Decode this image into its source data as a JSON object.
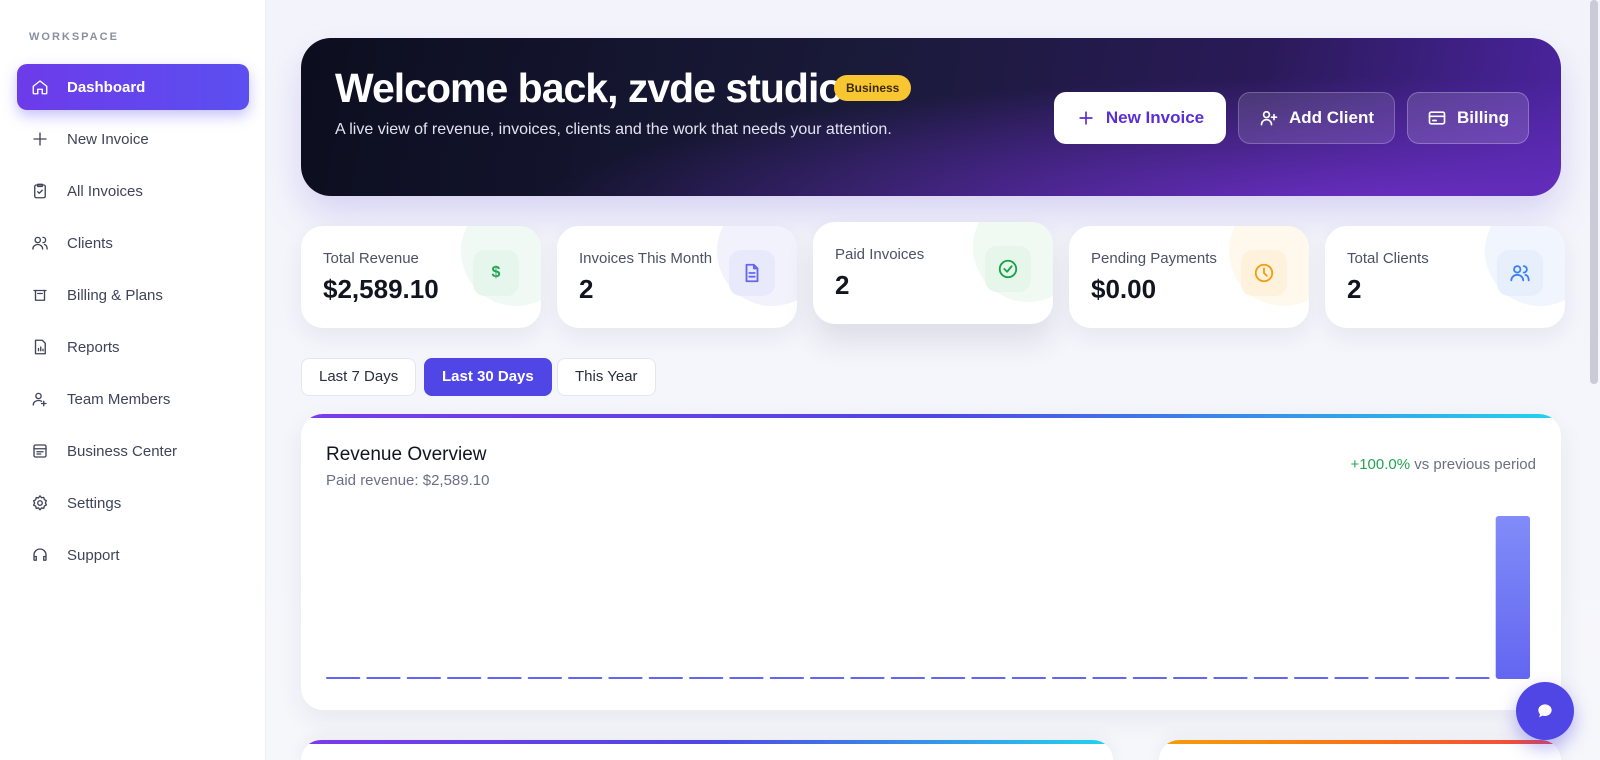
{
  "sidebar": {
    "section_label": "WORKSPACE",
    "items": [
      {
        "label": "Dashboard",
        "icon": "home-icon",
        "active": true
      },
      {
        "label": "New Invoice",
        "icon": "plus-icon"
      },
      {
        "label": "All Invoices",
        "icon": "clipboard-check-icon"
      },
      {
        "label": "Clients",
        "icon": "users-icon"
      },
      {
        "label": "Billing & Plans",
        "icon": "billing-icon"
      },
      {
        "label": "Reports",
        "icon": "report-icon"
      },
      {
        "label": "Team Members",
        "icon": "team-icon"
      },
      {
        "label": "Business Center",
        "icon": "building-icon"
      },
      {
        "label": "Settings",
        "icon": "gear-icon"
      },
      {
        "label": "Support",
        "icon": "headset-icon"
      }
    ]
  },
  "hero": {
    "title": "Welcome back, zvde studio",
    "badge": "Business",
    "subtitle": "A live view of revenue, invoices, clients and the work that needs your attention.",
    "buttons": {
      "new_invoice": "New Invoice",
      "add_client": "Add Client",
      "billing": "Billing"
    }
  },
  "stats": [
    {
      "label": "Total Revenue",
      "value": "$2,589.10",
      "icon": "dollar-icon",
      "color": "#22a553"
    },
    {
      "label": "Invoices This Month",
      "value": "2",
      "icon": "document-icon",
      "color": "#6366f1"
    },
    {
      "label": "Paid Invoices",
      "value": "2",
      "icon": "check-circle-icon",
      "color": "#16a34a"
    },
    {
      "label": "Pending Payments",
      "value": "$0.00",
      "icon": "clock-icon",
      "color": "#f59e0b"
    },
    {
      "label": "Total Clients",
      "value": "2",
      "icon": "users-icon",
      "color": "#3b82f6"
    }
  ],
  "ranges": {
    "last7": "Last 7 Days",
    "last30": "Last 30 Days",
    "year": "This Year",
    "selected": "Last 30 Days"
  },
  "revenue": {
    "title": "Revenue Overview",
    "subtitle": "Paid revenue: $2,589.10",
    "change_pct": "+100.0%",
    "change_text": " vs previous period"
  },
  "colors": {
    "accent": "#4f46e5",
    "brand_purple": "#6d3bea",
    "positive": "#22a553",
    "badge": "#f7c630"
  },
  "chart_data": {
    "type": "bar",
    "values": [
      0,
      0,
      0,
      0,
      0,
      0,
      0,
      0,
      0,
      0,
      0,
      0,
      0,
      0,
      0,
      0,
      0,
      0,
      0,
      0,
      0,
      0,
      0,
      0,
      0,
      0,
      0,
      0,
      0,
      2589.1
    ],
    "title": "Revenue Overview",
    "xlabel": "",
    "ylabel": "",
    "grid": false,
    "color": "#6366f1"
  }
}
